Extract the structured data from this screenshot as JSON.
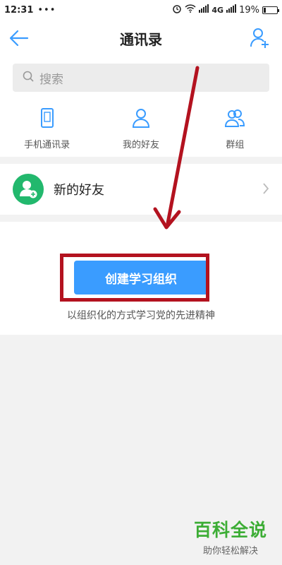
{
  "status_bar": {
    "time": "12:31",
    "dots": "•••",
    "network": "4G",
    "battery": "19%",
    "battery_level": 0.19
  },
  "header": {
    "title": "通讯录"
  },
  "search": {
    "placeholder": "搜索"
  },
  "tabs": [
    {
      "label": "手机通讯录",
      "icon": "phone-icon"
    },
    {
      "label": "我的好友",
      "icon": "person-icon"
    },
    {
      "label": "群组",
      "icon": "group-icon"
    }
  ],
  "new_friend": {
    "label": "新的好友",
    "icon": "add-friend-avatar-icon"
  },
  "create_org": {
    "button_label": "创建学习组织",
    "subtext": "以组织化的方式学习党的先进精神"
  },
  "watermark": {
    "title": "百科全说",
    "subtitle": "助你轻松解决"
  },
  "colors": {
    "accent": "#3a9cff",
    "avatar_green": "#22b86d",
    "annotation_red": "#b3121f",
    "watermark_green": "#3cad35"
  }
}
